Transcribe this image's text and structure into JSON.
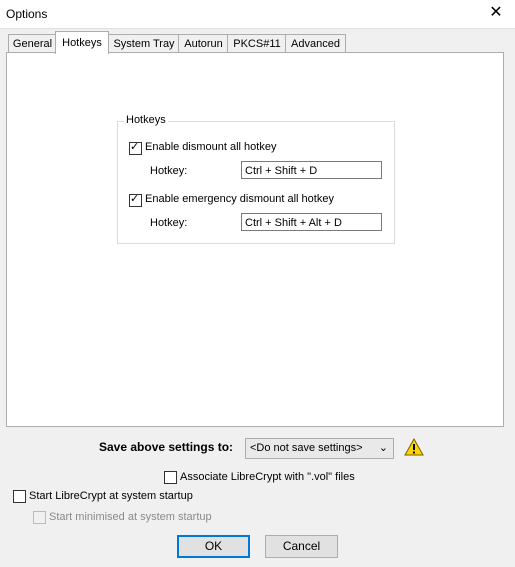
{
  "window": {
    "title": "Options",
    "close_glyph": "✕"
  },
  "tabs": [
    {
      "label": "General"
    },
    {
      "label": "Hotkeys"
    },
    {
      "label": "System Tray"
    },
    {
      "label": "Autorun"
    },
    {
      "label": "PKCS#11"
    },
    {
      "label": "Advanced"
    }
  ],
  "active_tab": "Hotkeys",
  "hotkeys_group": {
    "title": "Hotkeys",
    "dismount": {
      "label": "Enable dismount all hotkey",
      "checked": true,
      "hotkey_label": "Hotkey:",
      "hotkey_value": "Ctrl + Shift + D"
    },
    "emergency": {
      "label": "Enable emergency dismount all hotkey",
      "checked": true,
      "hotkey_label": "Hotkey:",
      "hotkey_value": "Ctrl + Shift + Alt + D"
    }
  },
  "save": {
    "label": "Save above settings to:",
    "selected": "<Do not save settings>",
    "warning_icon": "warning-icon"
  },
  "associate": {
    "label": "Associate LibreCrypt with \".vol\" files",
    "checked": false
  },
  "startup": {
    "label": "Start LibreCrypt at system startup",
    "checked": false
  },
  "minimised": {
    "label": "Start minimised at system startup",
    "checked": false,
    "disabled": true
  },
  "buttons": {
    "ok": "OK",
    "cancel": "Cancel"
  },
  "colors": {
    "accent": "#0078d7",
    "warning": "#ffd500"
  }
}
